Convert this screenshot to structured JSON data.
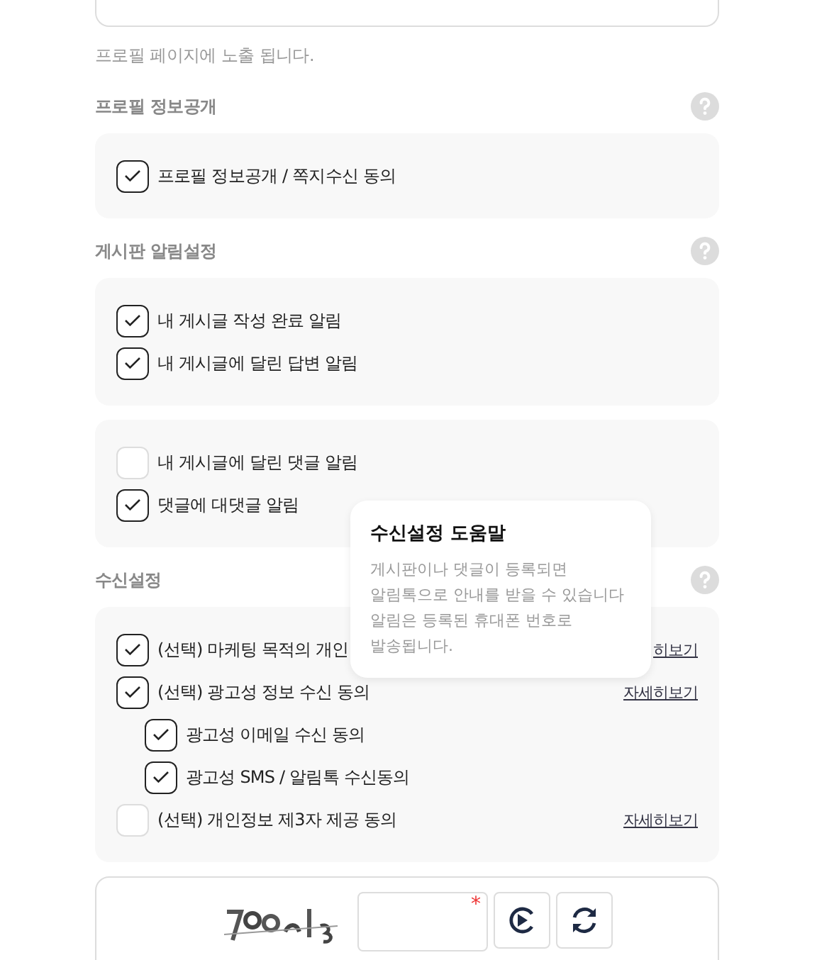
{
  "hint": "프로필 페이지에 노출 됩니다.",
  "sections": [
    {
      "title": "프로필 정보공개",
      "cards": [
        [
          {
            "label": "프로필 정보공개 / 쪽지수신 동의",
            "checked": true
          }
        ]
      ]
    },
    {
      "title": "게시판 알림설정",
      "cards": [
        [
          {
            "label": "내 게시글 작성 완료 알림",
            "checked": true
          },
          {
            "label": "내 게시글에 달린 답변 알림",
            "checked": true
          }
        ],
        [
          {
            "label": "내 게시글에 달린 댓글 알림",
            "checked": false
          },
          {
            "label": "댓글에 대댓글 알림",
            "checked": true
          }
        ]
      ]
    },
    {
      "title": "수신설정",
      "cards": [
        [
          {
            "label": "(선택) 마케팅 목적의 개인",
            "checked": true,
            "link": "히보기"
          },
          {
            "label": "(선택) 광고성 정보 수신 동의",
            "checked": true,
            "link": "자세히보기",
            "children": [
              {
                "label": "광고성 이메일 수신 동의",
                "checked": true
              },
              {
                "label": "광고성 SMS / 알림톡 수신동의",
                "checked": true
              }
            ]
          },
          {
            "label": "(선택) 개인정보 제3자 제공 동의",
            "checked": false,
            "link": "자세히보기"
          }
        ]
      ]
    }
  ],
  "tooltip": {
    "title": "수신설정 도움말",
    "body": "게시판이나 댓글이 등록되면\n알림톡으로 안내를 받을 수 있습니다\n알림은 등록된 휴대폰 번호로\n발송됩니다."
  },
  "captcha": {
    "required_mark": "*"
  }
}
